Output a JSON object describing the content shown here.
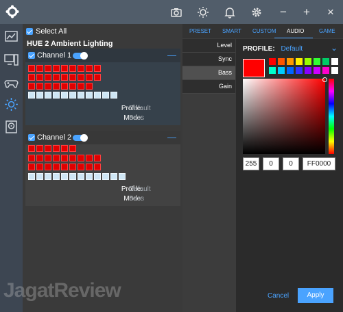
{
  "window": {
    "controls": {
      "minimize": "−",
      "maximize": "+",
      "close": "×"
    }
  },
  "icons": [
    "camera-icon",
    "brightness-icon",
    "bell-icon",
    "gear-icon"
  ],
  "left": {
    "select_all": "Select All",
    "device_title": "HUE 2 Ambient Lighting",
    "channels": [
      {
        "name": "Channel 1",
        "profile_k": "Profile:",
        "profile_v": "Default",
        "mode_k": "Mode:",
        "mode_v": "Bass"
      },
      {
        "name": "Channel 2",
        "profile_k": "Profile:",
        "profile_v": "Default",
        "mode_k": "Mode:",
        "mode_v": "Bass"
      }
    ]
  },
  "tabs": [
    "PRESET",
    "SMART",
    "CUSTOM",
    "AUDIO",
    "GAME"
  ],
  "active_tab": "AUDIO",
  "submenu": [
    "Level",
    "Sync",
    "Bass",
    "Gain"
  ],
  "active_submenu": "Bass",
  "color": {
    "profile_label": "PROFILE:",
    "profile_value": "Default",
    "r": "255",
    "g": "0",
    "b": "0",
    "hex": "FF0000",
    "swatches": [
      "#ff0000",
      "#ff5500",
      "#ff9900",
      "#ffee00",
      "#99ff00",
      "#33ff33",
      "#00cc66",
      "#ffffff",
      "#00ffcc",
      "#00ccff",
      "#0066ff",
      "#3333ff",
      "#8800ff",
      "#cc00ff",
      "#ff00cc",
      "#ffffff"
    ]
  },
  "buttons": {
    "cancel": "Cancel",
    "apply": "Apply"
  },
  "watermark": "JagatReview"
}
